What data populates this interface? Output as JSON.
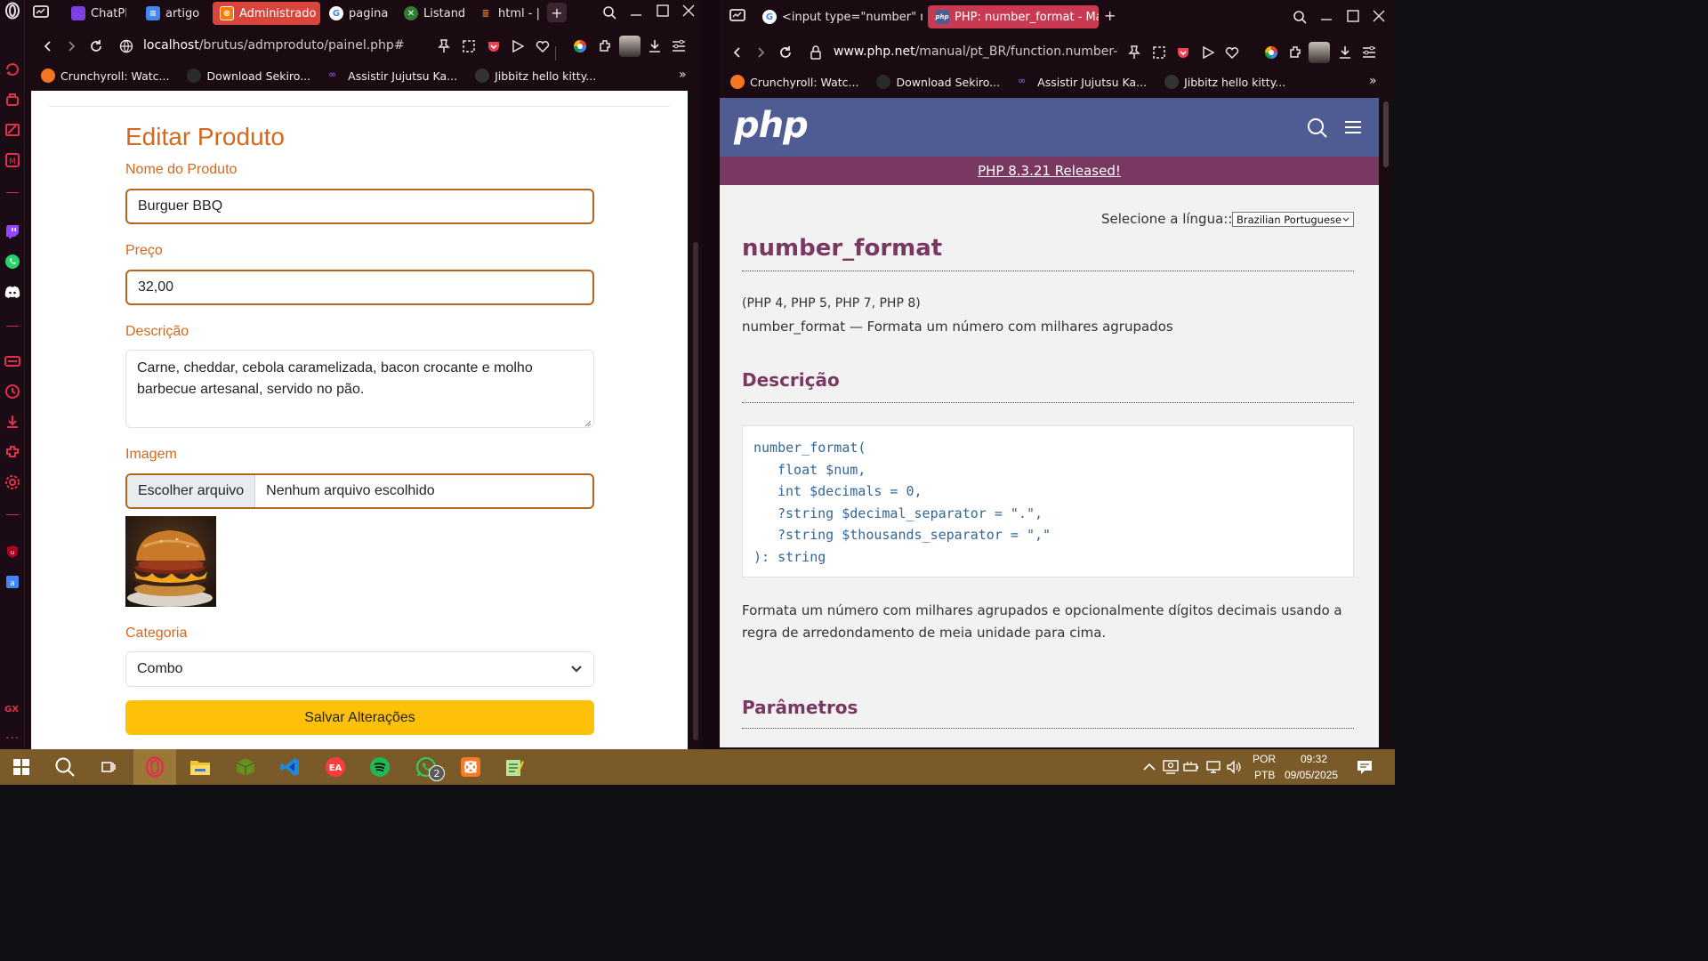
{
  "left_window": {
    "tabs": [
      {
        "label": "ChatPD",
        "color": "#7b3fe4"
      },
      {
        "label": "artigo",
        "color": "#4285f4"
      },
      {
        "label": "Administrado",
        "color": "#f57c00"
      },
      {
        "label": "pagina",
        "color": "#4285f4"
      },
      {
        "label": "Listand",
        "color": "#2e7d32"
      },
      {
        "label": "html - |",
        "color": "#f48024"
      }
    ],
    "url_host": "localhost",
    "url_path": "/brutus/admproduto/painel.php#",
    "bookmarks": [
      "Crunchyroll: Watc...",
      "Download Sekiro...",
      "Assistir Jujutsu Ka...",
      "Jibbitz hello kitty..."
    ]
  },
  "form": {
    "title": "Editar Produto",
    "name_label": "Nome do Produto",
    "name_value": "Burguer BBQ",
    "price_label": "Preço",
    "price_value": "32,00",
    "desc_label": "Descrição",
    "desc_value": "Carne, cheddar, cebola caramelizada, bacon crocante e molho barbecue artesanal, servido no pão.",
    "image_label": "Imagem",
    "file_button": "Escolher arquivo",
    "file_status": "Nenhum arquivo escolhido",
    "category_label": "Categoria",
    "category_value": "Combo",
    "submit_label": "Salvar Alterações"
  },
  "right_window": {
    "tabs": [
      {
        "label": "<input type=\"number\" na",
        "color": "#4285f4"
      },
      {
        "label": "PHP: number_format - Ma",
        "color": "#4f5b93"
      }
    ],
    "url_host": "www.php.net",
    "url_path": "/manual/pt_BR/function.number-form",
    "bookmarks": [
      "Crunchyroll: Watc...",
      "Download Sekiro...",
      "Assistir Jujutsu Ka...",
      "Jibbitz hello kitty..."
    ]
  },
  "php": {
    "logo": "php",
    "news": "PHP 8.3.21 Released!",
    "lang_label": "Selecione a língua::",
    "lang_value": "Brazilian Portuguese",
    "func_name": "number_format",
    "versions": "(PHP 4, PHP 5, PHP 7, PHP 8)",
    "summary": "number_format — Formata um número com milhares agrupados",
    "desc_heading": "Descrição",
    "code_lines": [
      "number_format(",
      "float $num,",
      "int $decimals = 0,",
      "?string $decimal_separator = \".\",",
      "?string $thousands_separator = \",\"",
      "): string"
    ],
    "description": "Formata um número com milhares agrupados e opcionalmente dígitos decimais usando a regra de arredondamento de meia unidade para cima.",
    "params_heading": "Parâmetros"
  },
  "taskbar": {
    "lang_top": "POR",
    "lang_bottom": "PTB",
    "time": "09:32",
    "date": "09/05/2025",
    "whatsapp_badge": "2"
  }
}
